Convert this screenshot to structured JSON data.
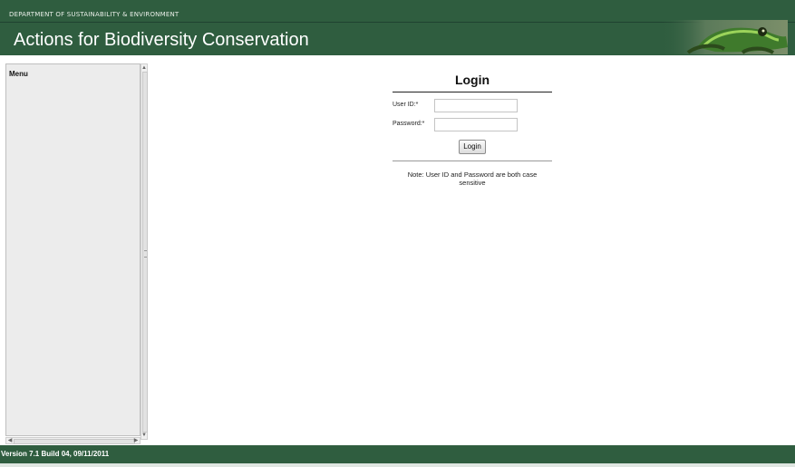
{
  "header": {
    "department": "DEPARTMENT OF SUSTAINABILITY & ENVIRONMENT",
    "title": "Actions for Biodiversity Conservation"
  },
  "sidebar": {
    "label": "Menu"
  },
  "login": {
    "title": "Login",
    "user_id_label": "User ID:*",
    "user_id_value": "",
    "password_label": "Password:*",
    "password_value": "",
    "button_label": "Login",
    "note": "Note: User ID and Password are both case sensitive"
  },
  "footer": {
    "version": "Version 7.1 Build 04, 09/11/2011"
  },
  "colors": {
    "header_bg": "#2f5d3f",
    "footer_bg": "#2f5d3f",
    "sidebar_bg": "#ececec"
  },
  "icons": {
    "header_image": "frog-image"
  }
}
